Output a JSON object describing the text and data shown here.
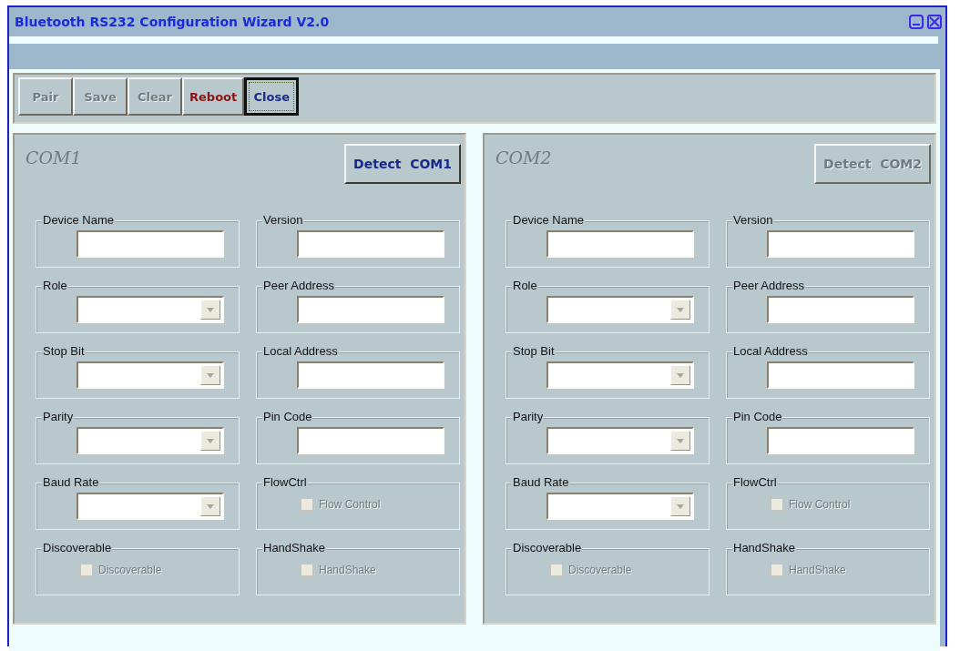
{
  "window": {
    "title": "Bluetooth RS232 Configuration Wizard V2.0"
  },
  "toolbar": [
    {
      "label": "Pair",
      "disabled": true,
      "focused": false,
      "kind": "normal"
    },
    {
      "label": "Save",
      "disabled": true,
      "focused": false,
      "kind": "normal"
    },
    {
      "label": "Clear",
      "disabled": true,
      "focused": false,
      "kind": "normal"
    },
    {
      "label": "Reboot",
      "disabled": false,
      "focused": false,
      "kind": "danger"
    },
    {
      "label": "Close",
      "disabled": false,
      "focused": true,
      "kind": "normal"
    }
  ],
  "panels": [
    {
      "title": "COM1",
      "detect_button": {
        "label": "Detect  COM1",
        "disabled": false
      },
      "fields": [
        {
          "kind": "text",
          "label": "Device Name"
        },
        {
          "kind": "text",
          "label": "Version"
        },
        {
          "kind": "combo",
          "label": "Role"
        },
        {
          "kind": "text",
          "label": "Peer Address"
        },
        {
          "kind": "combo",
          "label": "Stop Bit"
        },
        {
          "kind": "text",
          "label": "Local Address"
        },
        {
          "kind": "combo",
          "label": "Parity"
        },
        {
          "kind": "text",
          "label": "Pin Code"
        },
        {
          "kind": "combo",
          "label": "Baud Rate"
        },
        {
          "kind": "checkbox",
          "label": "FlowCtrl",
          "option": "Flow Control",
          "checked": false,
          "disabled": true
        },
        {
          "kind": "checkbox",
          "label": "Discoverable",
          "option": "Discoverable",
          "checked": false,
          "disabled": true
        },
        {
          "kind": "checkbox",
          "label": "HandShake",
          "option": "HandShake",
          "checked": false,
          "disabled": true
        }
      ]
    },
    {
      "title": "COM2",
      "detect_button": {
        "label": "Detect  COM2",
        "disabled": true
      },
      "fields": [
        {
          "kind": "text",
          "label": "Device Name"
        },
        {
          "kind": "text",
          "label": "Version"
        },
        {
          "kind": "combo",
          "label": "Role"
        },
        {
          "kind": "text",
          "label": "Peer Address"
        },
        {
          "kind": "combo",
          "label": "Stop Bit"
        },
        {
          "kind": "text",
          "label": "Local Address"
        },
        {
          "kind": "combo",
          "label": "Parity"
        },
        {
          "kind": "text",
          "label": "Pin Code"
        },
        {
          "kind": "combo",
          "label": "Baud Rate"
        },
        {
          "kind": "checkbox",
          "label": "FlowCtrl",
          "option": "Flow Control",
          "checked": false,
          "disabled": true
        },
        {
          "kind": "checkbox",
          "label": "Discoverable",
          "option": "Discoverable",
          "checked": false,
          "disabled": true
        },
        {
          "kind": "checkbox",
          "label": "HandShake",
          "option": "HandShake",
          "checked": false,
          "disabled": true
        }
      ]
    }
  ]
}
